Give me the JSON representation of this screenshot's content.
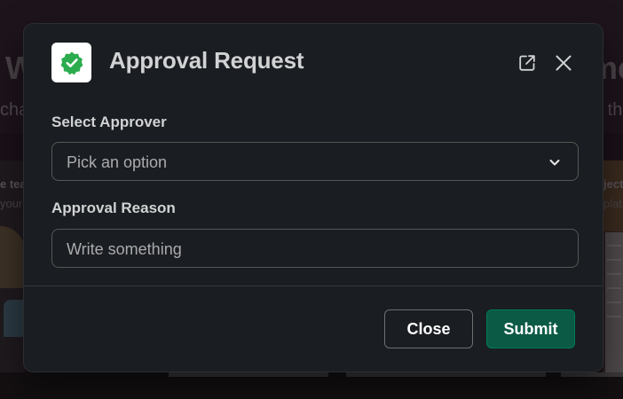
{
  "background": {
    "fragments": {
      "left_heading": "W",
      "left_sub": "cha",
      "right_heading": "me",
      "right_sub": "o th",
      "left_card_title": "e tea",
      "left_card_sub": "your",
      "right_card_title": "ject",
      "right_card_sub": "plat"
    }
  },
  "modal": {
    "title": "Approval Request",
    "header_icons": {
      "app": "verified-badge-icon",
      "popout": "external-link-icon",
      "close": "close-icon"
    },
    "fields": {
      "approver": {
        "label": "Select Approver",
        "placeholder": "Pick an option"
      },
      "reason": {
        "label": "Approval Reason",
        "placeholder": "Write something"
      }
    },
    "buttons": {
      "close": "Close",
      "submit": "Submit"
    }
  },
  "colors": {
    "modal_bg": "#1a1d21",
    "badge_green": "#2bac4e",
    "submit_green": "#0b5a45",
    "text_primary": "#d1d2d3"
  }
}
